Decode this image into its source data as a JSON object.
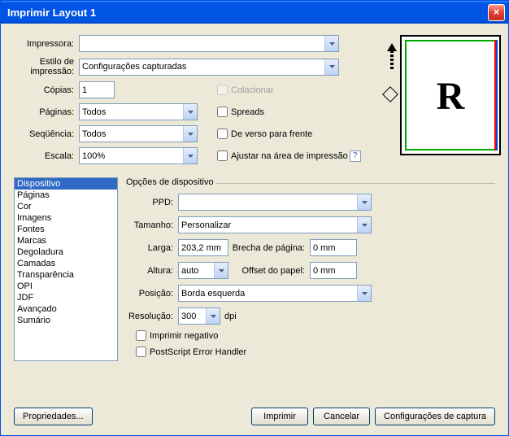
{
  "window": {
    "title": "Imprimir Layout 1"
  },
  "form": {
    "printer_label": "Impressora:",
    "printer_value": "",
    "style_label": "Estilo de impressão:",
    "style_value": "Configurações capturadas",
    "copies_label": "Cópias:",
    "copies_value": "1",
    "collate_label": "Colacionar",
    "pages_label": "Páginas:",
    "pages_value": "Todos",
    "spreads_label": "Spreads",
    "sequence_label": "Seqüência:",
    "sequence_value": "Todos",
    "back_front_label": "De verso para frente",
    "scale_label": "Escala:",
    "scale_value": "100%",
    "fit_label": "Ajustar na área de impressão"
  },
  "preview": {
    "letter": "R"
  },
  "list": {
    "items": [
      "Dispositivo",
      "Páginas",
      "Cor",
      "Imagens",
      "Fontes",
      "Marcas",
      "Degoladura",
      "Camadas",
      "Transparência",
      "OPI",
      "JDF",
      "Avançado",
      "Sumário"
    ],
    "selected_index": 0
  },
  "panel": {
    "title": "Opções de dispositivo",
    "ppd_label": "PPD:",
    "ppd_value": "",
    "size_label": "Tamanho:",
    "size_value": "Personalizar",
    "width_label": "Larga:",
    "width_value": "203,2 mm",
    "gap_label": "Brecha de página:",
    "gap_value": "0 mm",
    "height_label": "Altura:",
    "height_value": "auto",
    "offset_label": "Offset do papel:",
    "offset_value": "0 mm",
    "position_label": "Posição:",
    "position_value": "Borda esquerda",
    "resolution_label": "Resolução:",
    "resolution_value": "300",
    "resolution_unit": "dpi",
    "negative_label": "Imprimir negativo",
    "ps_error_label": "PostScript Error Handler"
  },
  "buttons": {
    "properties": "Propriedades...",
    "print": "Imprimir",
    "cancel": "Cancelar",
    "capture": "Configurações de captura"
  }
}
